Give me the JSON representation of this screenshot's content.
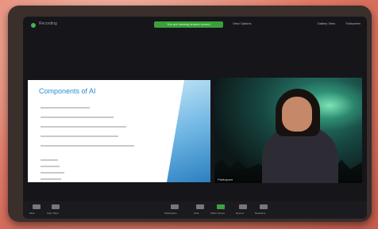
{
  "topbar": {
    "app_name": "Recording",
    "banner": "You are viewing shared screen",
    "view_options": "View Options",
    "gallery_view": "Gallery View",
    "fullscreen": "Fullscreen"
  },
  "slide": {
    "title": "Components of AI"
  },
  "participant": {
    "name": "Participant"
  },
  "toolbar": {
    "items": [
      "Mute",
      "Stop Video",
      "Participants",
      "Chat",
      "Share Screen",
      "Record",
      "Reactions"
    ]
  },
  "colors": {
    "accent": "#3aa13a",
    "slide_title": "#2b8dd2"
  }
}
